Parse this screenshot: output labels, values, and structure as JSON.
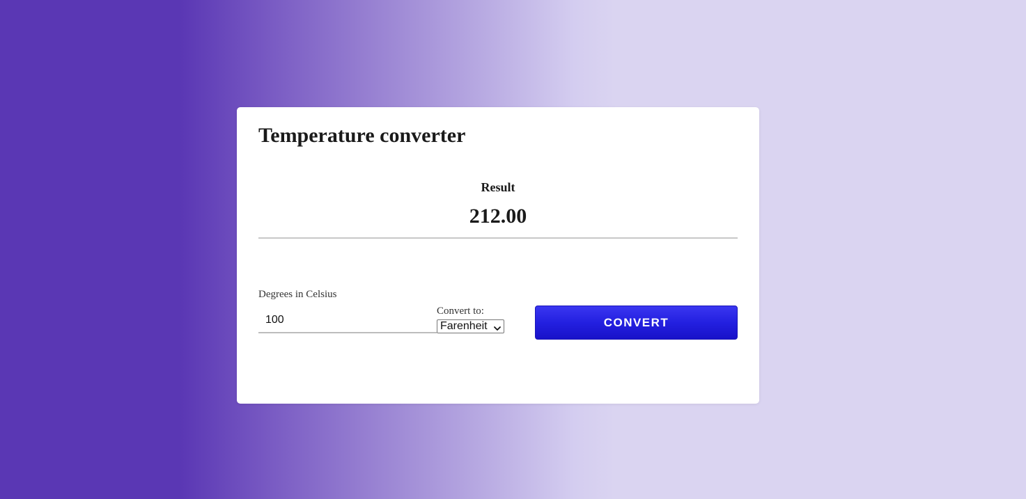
{
  "app": {
    "title": "Temperature converter"
  },
  "result": {
    "label": "Result",
    "value": "212.00"
  },
  "form": {
    "celsius_label": "Degrees in Celsius",
    "celsius_value": "100",
    "convert_to_label": "Convert to:",
    "unit_selected": "Farenheit",
    "convert_button_label": "CONVERT"
  },
  "icons": {
    "select_arrow": "chevron-down-icon"
  },
  "colors": {
    "background_dark": "#5a37b4",
    "background_light": "#dad4f1",
    "button": "#2320e0",
    "card": "#ffffff"
  }
}
